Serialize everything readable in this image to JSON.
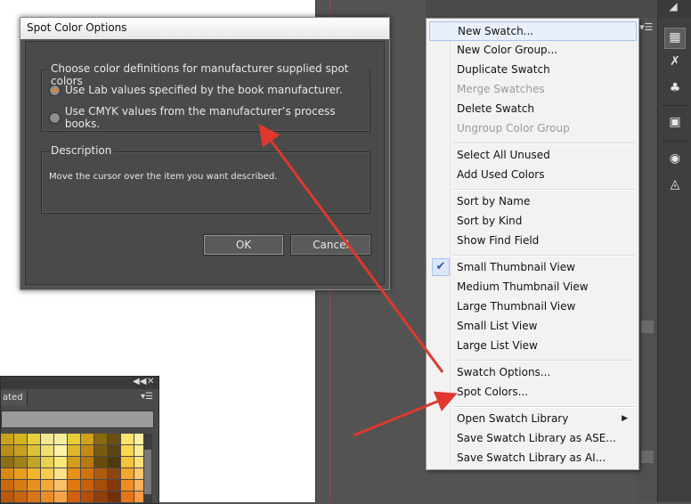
{
  "dialog": {
    "title": "Spot Color Options",
    "group_label": "Choose color definitions for manufacturer supplied spot colors",
    "options": [
      {
        "label": "Use Lab values specified by the book manufacturer.",
        "selected": true
      },
      {
        "label": "Use CMYK values from the manufacturer’s process books.",
        "selected": false
      }
    ],
    "description_label": "Description",
    "description_text": "Move the cursor over the item you want described.",
    "ok_label": "OK",
    "cancel_label": "Cancel"
  },
  "swatches_panel": {
    "tab_label": "ated",
    "colors": [
      "#c9a21a",
      "#d6b21c",
      "#e6cf3a",
      "#f3e690",
      "#f6ee9e",
      "#e8cc36",
      "#d4a21a",
      "#8a6a0e",
      "#6a5010",
      "#ffe36a",
      "#fff1a0",
      "#b8901a",
      "#c8a020",
      "#dcc238",
      "#f0e070",
      "#fff3a8",
      "#e0b628",
      "#c48a14",
      "#7a5a10",
      "#5a4410",
      "#ffd850",
      "#ffec90",
      "#8c6e14",
      "#a08018",
      "#c4a428",
      "#e8d050",
      "#fbe87a",
      "#d49c1c",
      "#b87a10",
      "#6a4a0c",
      "#4e3a0a",
      "#f6c438",
      "#ffe27a",
      "#d88a12",
      "#e89e1e",
      "#f2b42e",
      "#f8cc50",
      "#fce08a",
      "#e8901a",
      "#d07410",
      "#b05c0e",
      "#8c460c",
      "#f4a830",
      "#ffc870",
      "#c86a0e",
      "#d87c14",
      "#e8901e",
      "#f4a838",
      "#fac068",
      "#e07812",
      "#c8600e",
      "#a84c0c",
      "#84380a",
      "#f08c24",
      "#ffb058",
      "#b8580c",
      "#c86410",
      "#d87618",
      "#e88c28",
      "#f4a448",
      "#d06010",
      "#b44c0c",
      "#92400a",
      "#723008",
      "#e87418",
      "#fb9a40"
    ]
  },
  "context_menu": {
    "items": [
      {
        "label": "New Swatch...",
        "disabled": false,
        "highlighted": true
      },
      {
        "label": "New Color Group...",
        "disabled": false
      },
      {
        "label": "Duplicate Swatch",
        "disabled": false
      },
      {
        "label": "Merge Swatches",
        "disabled": true
      },
      {
        "label": "Delete Swatch",
        "disabled": false
      },
      {
        "label": "Ungroup Color Group",
        "disabled": true
      },
      {
        "label": "Select All Unused",
        "disabled": false
      },
      {
        "label": "Add Used Colors",
        "disabled": false
      },
      {
        "label": "Sort by Name",
        "disabled": false
      },
      {
        "label": "Sort by Kind",
        "disabled": false
      },
      {
        "label": "Show Find Field",
        "disabled": false
      },
      {
        "label": "Small Thumbnail View",
        "disabled": false,
        "checked": true
      },
      {
        "label": "Medium Thumbnail View",
        "disabled": false
      },
      {
        "label": "Large Thumbnail View",
        "disabled": false
      },
      {
        "label": "Small List View",
        "disabled": false
      },
      {
        "label": "Large List View",
        "disabled": false
      },
      {
        "label": "Swatch Options...",
        "disabled": false
      },
      {
        "label": "Spot Colors...",
        "disabled": false
      },
      {
        "label": "Open Swatch Library",
        "disabled": false,
        "submenu": true
      },
      {
        "label": "Save Swatch Library as ASE...",
        "disabled": false
      },
      {
        "label": "Save Swatch Library as AI...",
        "disabled": false
      }
    ],
    "checkmark": "✔",
    "submenu_arrow": "▶"
  },
  "toolbar_icons": [
    "artboard-icon",
    "swatches-icon",
    "brushes-icon",
    "symbols-icon",
    "gradient-icon",
    "appearance-icon",
    "graphic-styles-icon"
  ],
  "colors": {
    "annotation_arrow": "#e0382e",
    "dialog_title_bg": "#f0f0f0",
    "radio_selected": "#e6821e",
    "menu_highlight": "#a8c4ec"
  }
}
